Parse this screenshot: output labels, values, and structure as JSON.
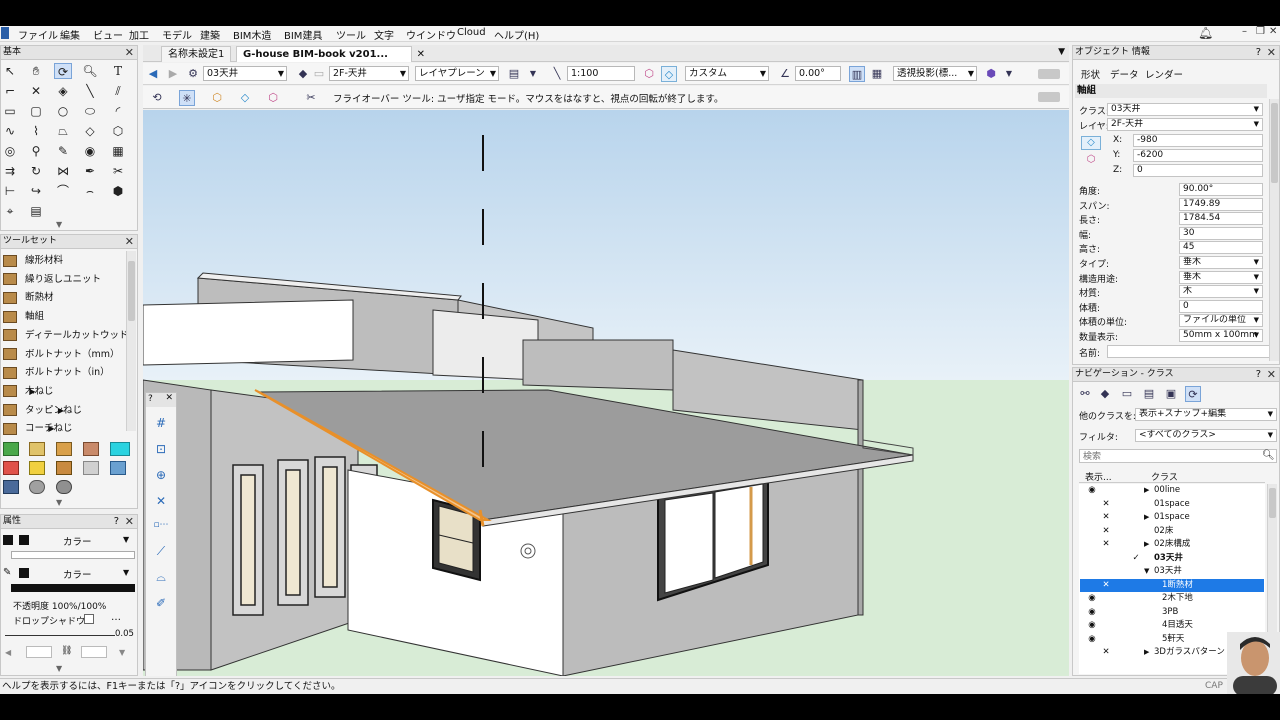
{
  "menu": [
    "ファイル",
    "編集",
    "ビュー",
    "加工",
    "モデル",
    "建築",
    "BIM木造",
    "BIM建具",
    "ツール",
    "文字",
    "ウインドウ",
    "Cloud",
    "ヘルプ(H)"
  ],
  "palettes": {
    "basic_title": "基本",
    "toolset_title": "ツールセット",
    "toolset_items": [
      {
        "label": "線形材料",
        "submenu": false
      },
      {
        "label": "繰り返しユニット",
        "submenu": false
      },
      {
        "label": "断熱材",
        "submenu": false
      },
      {
        "label": "軸組",
        "submenu": false
      },
      {
        "label": "ディテールカットウッド",
        "submenu": false
      },
      {
        "label": "ボルトナット（mm）",
        "submenu": false
      },
      {
        "label": "ボルトナット（in）",
        "submenu": false
      },
      {
        "label": "木ねじ",
        "submenu": true
      },
      {
        "label": "タッピンねじ",
        "submenu": true
      },
      {
        "label": "コーチねじ",
        "submenu": true
      }
    ],
    "attributes_title": "属性",
    "attr_fill_label": "カラー",
    "attr_pen_label": "カラー",
    "opacity": "不透明度 100%/100%",
    "drop_shadow": "ドロップシャドウ",
    "line_weight": "0.05"
  },
  "document_tabs": [
    {
      "label": "名称未設定1",
      "active": false
    },
    {
      "label": "G-house BIM-book v201...",
      "active": true
    }
  ],
  "viewbar": {
    "class": "03天井",
    "layer": "2F-天井",
    "layer_mode": "レイヤプレーン",
    "scale": "1:100",
    "render_mode": "カスタム",
    "rotation": "0.00°",
    "projection": "透視投影(標..."
  },
  "mode_message": "フライオーバー ツール: ユーザ指定 モード。マウスをはなすと、視点の回転が終了します。",
  "obj_info": {
    "title": "オブジェクト 情報",
    "tabs": [
      "形状",
      "データ",
      "レンダー"
    ],
    "object_type": "軸組",
    "class_label": "クラス:",
    "class_value": "03天井",
    "layer_label": "レイヤ:",
    "layer_value": "2F-天井",
    "x_label": "X:",
    "x": "-980",
    "y_label": "Y:",
    "y": "-6200",
    "z_label": "Z:",
    "z": "0",
    "fields": [
      {
        "label": "角度:",
        "value": "90.00°",
        "dropdown": false
      },
      {
        "label": "スパン:",
        "value": "1749.89",
        "dropdown": false
      },
      {
        "label": "長さ:",
        "value": "1784.54",
        "dropdown": false
      },
      {
        "label": "幅:",
        "value": "30",
        "dropdown": false
      },
      {
        "label": "高さ:",
        "value": "45",
        "dropdown": false
      },
      {
        "label": "タイプ:",
        "value": "垂木",
        "dropdown": true
      },
      {
        "label": "構造用途:",
        "value": "垂木",
        "dropdown": true
      },
      {
        "label": "材質:",
        "value": "木",
        "dropdown": true
      },
      {
        "label": "体積:",
        "value": "0",
        "dropdown": false
      },
      {
        "label": "体積の単位:",
        "value": "ファイルの単位",
        "dropdown": true
      },
      {
        "label": "数量表示:",
        "value": "50mm x 100mm",
        "dropdown": true
      }
    ],
    "name_label": "名前:"
  },
  "navigation": {
    "title": "ナビゲーション - クラス",
    "other_classes_label": "他のクラスを:",
    "other_classes_value": "表示+スナップ+編集",
    "filter_label": "フィルタ:",
    "filter_value": "<すべてのクラス>",
    "search_placeholder": "検索",
    "col_visibility": "表示...",
    "col_class": "クラス",
    "rows": [
      {
        "name": "00line",
        "vis": "eye",
        "indent": 0,
        "tri": "▶",
        "active": false,
        "sel": false,
        "bold": false
      },
      {
        "name": "01space",
        "vis": "x",
        "indent": 0,
        "tri": "",
        "active": false,
        "sel": false,
        "bold": false
      },
      {
        "name": "01space",
        "vis": "x",
        "indent": 0,
        "tri": "▶",
        "active": false,
        "sel": false,
        "bold": false
      },
      {
        "name": "02床",
        "vis": "x",
        "indent": 0,
        "tri": "",
        "active": false,
        "sel": false,
        "bold": false
      },
      {
        "name": "02床構成",
        "vis": "x",
        "indent": 0,
        "tri": "▶",
        "active": false,
        "sel": false,
        "bold": false
      },
      {
        "name": "03天井",
        "vis": "",
        "indent": 0,
        "tri": "",
        "active": true,
        "sel": false,
        "bold": true
      },
      {
        "name": "03天井",
        "vis": "",
        "indent": 0,
        "tri": "▼",
        "active": false,
        "sel": false,
        "bold": false
      },
      {
        "name": "1断熱材",
        "vis": "x",
        "indent": 1,
        "tri": "",
        "active": false,
        "sel": true,
        "bold": false
      },
      {
        "name": "2木下地",
        "vis": "eye",
        "indent": 1,
        "tri": "",
        "active": false,
        "sel": false,
        "bold": false
      },
      {
        "name": "3PB",
        "vis": "eye",
        "indent": 1,
        "tri": "",
        "active": false,
        "sel": false,
        "bold": false
      },
      {
        "name": "4目透天",
        "vis": "eye",
        "indent": 1,
        "tri": "",
        "active": false,
        "sel": false,
        "bold": false
      },
      {
        "name": "5軒天",
        "vis": "eye",
        "indent": 1,
        "tri": "",
        "active": false,
        "sel": false,
        "bold": false
      },
      {
        "name": "3Dガラスパターン",
        "vis": "x",
        "indent": 0,
        "tri": "▶",
        "active": false,
        "sel": false,
        "bold": false
      }
    ]
  },
  "status_text": "ヘルプを表示するには、F1キーまたは「?」アイコンをクリックしてください。",
  "status_caps": "CAP",
  "colors": {
    "accent": "#1e7ae6",
    "highlight": "#e8902a",
    "sky": "#cfe3f3",
    "ground": "#d8ecd6"
  }
}
